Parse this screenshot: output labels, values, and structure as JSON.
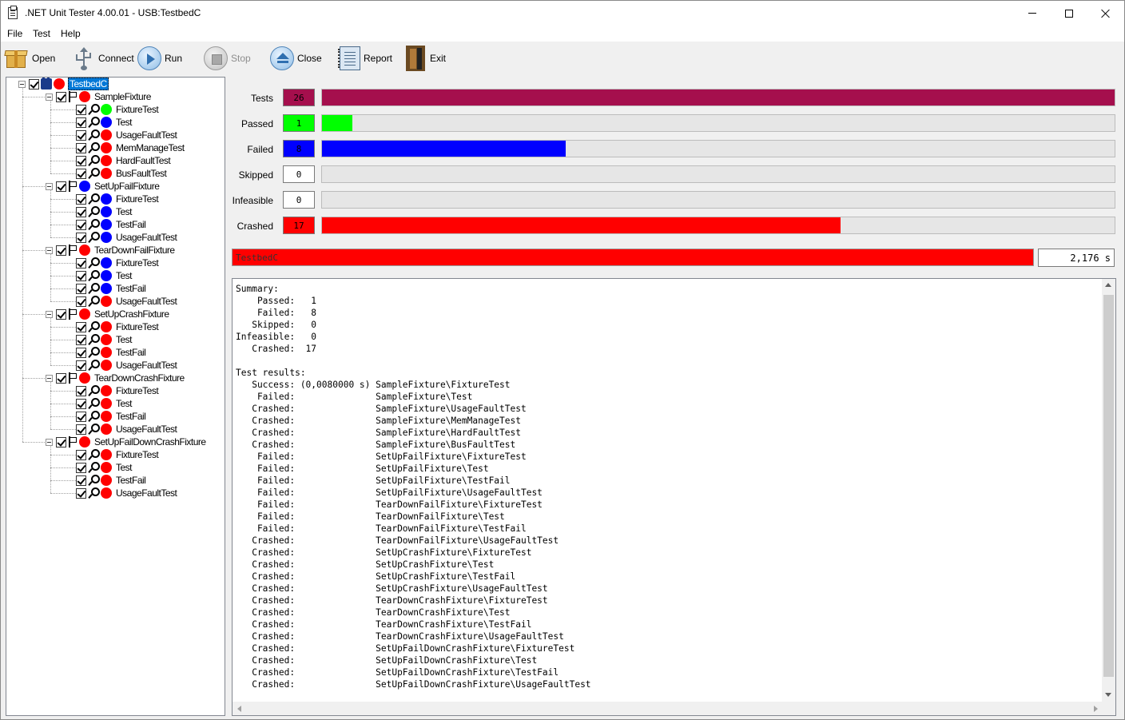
{
  "window": {
    "title": ".NET Unit Tester 4.00.01 - USB:TestbedC"
  },
  "menu": {
    "file": "File",
    "test": "Test",
    "help": "Help"
  },
  "toolbar": {
    "open": "Open",
    "connect": "Connect",
    "run": "Run",
    "stop": "Stop",
    "close": "Close",
    "report": "Report",
    "exit": "Exit"
  },
  "colors": {
    "passed": "#00ff00",
    "failed": "#0000ff",
    "crashed": "#ff0000",
    "tests": "#a50f4d"
  },
  "tree": {
    "root": {
      "label": "TestbedC",
      "status": "crashed"
    },
    "fixtures": [
      {
        "label": "SampleFixture",
        "status": "crashed",
        "tests": [
          {
            "label": "FixtureTest",
            "status": "passed"
          },
          {
            "label": "Test",
            "status": "failed"
          },
          {
            "label": "UsageFaultTest",
            "status": "crashed"
          },
          {
            "label": "MemManageTest",
            "status": "crashed"
          },
          {
            "label": "HardFaultTest",
            "status": "crashed"
          },
          {
            "label": "BusFaultTest",
            "status": "crashed"
          }
        ]
      },
      {
        "label": "SetUpFailFixture",
        "status": "failed",
        "tests": [
          {
            "label": "FixtureTest",
            "status": "failed"
          },
          {
            "label": "Test",
            "status": "failed"
          },
          {
            "label": "TestFail",
            "status": "failed"
          },
          {
            "label": "UsageFaultTest",
            "status": "failed"
          }
        ]
      },
      {
        "label": "TearDownFailFixture",
        "status": "crashed",
        "tests": [
          {
            "label": "FixtureTest",
            "status": "failed"
          },
          {
            "label": "Test",
            "status": "failed"
          },
          {
            "label": "TestFail",
            "status": "failed"
          },
          {
            "label": "UsageFaultTest",
            "status": "crashed"
          }
        ]
      },
      {
        "label": "SetUpCrashFixture",
        "status": "crashed",
        "tests": [
          {
            "label": "FixtureTest",
            "status": "crashed"
          },
          {
            "label": "Test",
            "status": "crashed"
          },
          {
            "label": "TestFail",
            "status": "crashed"
          },
          {
            "label": "UsageFaultTest",
            "status": "crashed"
          }
        ]
      },
      {
        "label": "TearDownCrashFixture",
        "status": "crashed",
        "tests": [
          {
            "label": "FixtureTest",
            "status": "crashed"
          },
          {
            "label": "Test",
            "status": "crashed"
          },
          {
            "label": "TestFail",
            "status": "crashed"
          },
          {
            "label": "UsageFaultTest",
            "status": "crashed"
          }
        ]
      },
      {
        "label": "SetUpFailDownCrashFixture",
        "status": "crashed",
        "tests": [
          {
            "label": "FixtureTest",
            "status": "crashed"
          },
          {
            "label": "Test",
            "status": "crashed"
          },
          {
            "label": "TestFail",
            "status": "crashed"
          },
          {
            "label": "UsageFaultTest",
            "status": "crashed"
          }
        ]
      }
    ]
  },
  "stats": [
    {
      "label": "Tests",
      "value": "26",
      "fraction": 1.0,
      "color": "#a50f4d"
    },
    {
      "label": "Passed",
      "value": "1",
      "fraction": 0.0385,
      "color": "#00ff00"
    },
    {
      "label": "Failed",
      "value": "8",
      "fraction": 0.3077,
      "color": "#0000ff"
    },
    {
      "label": "Skipped",
      "value": "0",
      "fraction": 0,
      "color": "#e6e6e6"
    },
    {
      "label": "Infeasible",
      "value": "0",
      "fraction": 0,
      "color": "#e6e6e6"
    },
    {
      "label": "Crashed",
      "value": "17",
      "fraction": 0.6538,
      "color": "#ff0000"
    }
  ],
  "overall": {
    "label": "TestbedC",
    "time": "2,176 s"
  },
  "results_text": "Summary:\n    Passed:   1\n    Failed:   8\n   Skipped:   0\nInfeasible:   0\n   Crashed:  17\n\nTest results:\n   Success: (0,0080000 s) SampleFixture\\FixtureTest\n    Failed:               SampleFixture\\Test\n   Crashed:               SampleFixture\\UsageFaultTest\n   Crashed:               SampleFixture\\MemManageTest\n   Crashed:               SampleFixture\\HardFaultTest\n   Crashed:               SampleFixture\\BusFaultTest\n    Failed:               SetUpFailFixture\\FixtureTest\n    Failed:               SetUpFailFixture\\Test\n    Failed:               SetUpFailFixture\\TestFail\n    Failed:               SetUpFailFixture\\UsageFaultTest\n    Failed:               TearDownFailFixture\\FixtureTest\n    Failed:               TearDownFailFixture\\Test\n    Failed:               TearDownFailFixture\\TestFail\n   Crashed:               TearDownFailFixture\\UsageFaultTest\n   Crashed:               SetUpCrashFixture\\FixtureTest\n   Crashed:               SetUpCrashFixture\\Test\n   Crashed:               SetUpCrashFixture\\TestFail\n   Crashed:               SetUpCrashFixture\\UsageFaultTest\n   Crashed:               TearDownCrashFixture\\FixtureTest\n   Crashed:               TearDownCrashFixture\\Test\n   Crashed:               TearDownCrashFixture\\TestFail\n   Crashed:               TearDownCrashFixture\\UsageFaultTest\n   Crashed:               SetUpFailDownCrashFixture\\FixtureTest\n   Crashed:               SetUpFailDownCrashFixture\\Test\n   Crashed:               SetUpFailDownCrashFixture\\TestFail\n   Crashed:               SetUpFailDownCrashFixture\\UsageFaultTest"
}
